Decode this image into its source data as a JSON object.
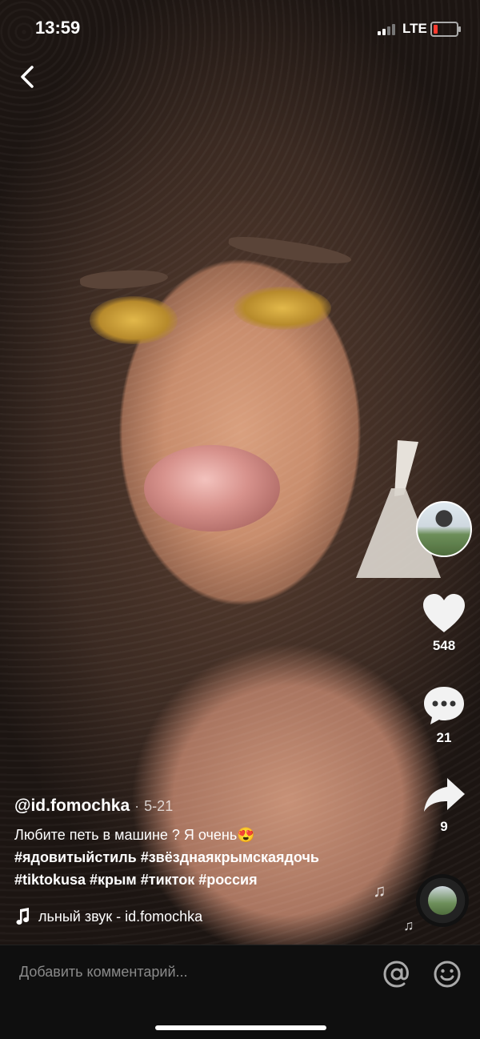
{
  "status_bar": {
    "time": "13:59",
    "network": "LTE"
  },
  "actions": {
    "likes": "548",
    "comments": "21",
    "shares": "9"
  },
  "post": {
    "username": "@id.fomochka",
    "separator": "·",
    "date": "5-21",
    "description": "Любите петь в машине ? Я очень😍",
    "hashtags_line1": "#ядовитыйстиль #звёзднаякрымскаядочь",
    "hashtags_line2": "#tiktokusa #крым #тикток #россия",
    "sound": "льный звук - id.fomochka"
  },
  "comment_bar": {
    "placeholder": "Добавить комментарий..."
  },
  "colors": {
    "battery_low": "#ff3b30",
    "comment_bar_bg": "#0f0f0f"
  }
}
